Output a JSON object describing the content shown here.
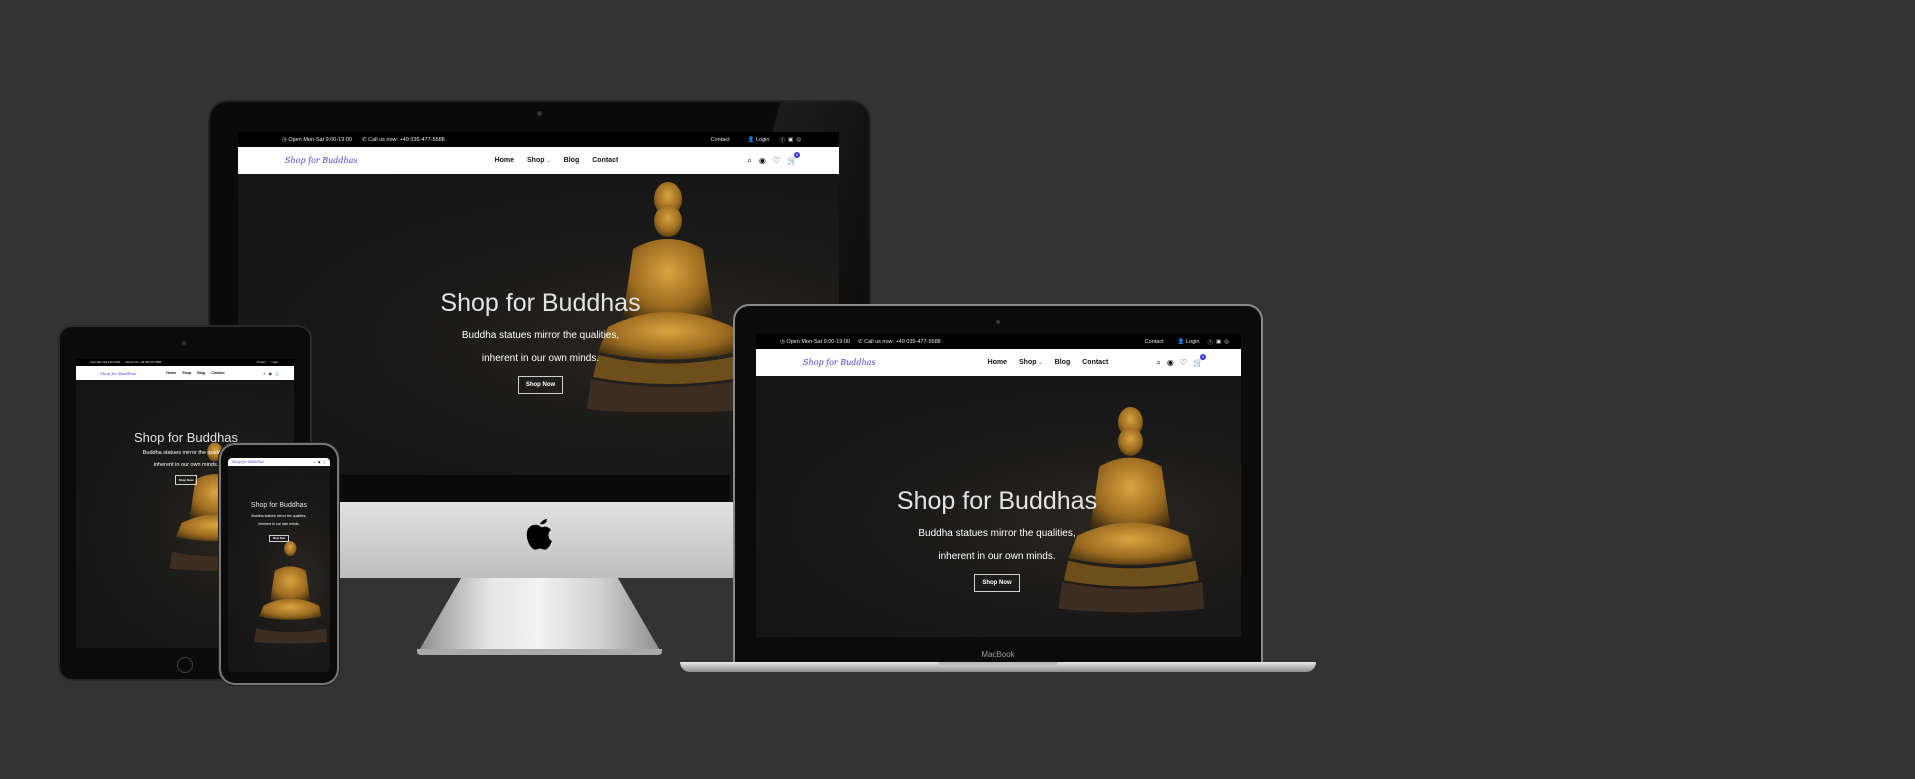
{
  "site": {
    "topbar": {
      "hours": "Open Mon-Sat 9:00-19:00",
      "phone": "Call us now: +49 035-477-5588",
      "contact": "Contact",
      "login": "Login"
    },
    "logo": "Shop for Buddhas",
    "menu": {
      "home": "Home",
      "shop": "Shop",
      "blog": "Blog",
      "contact": "Contact"
    },
    "cart_count": "0",
    "hero": {
      "title": "Shop for Buddhas",
      "line1": "Buddha statues mirror the qualities,",
      "line2": "inherent in our own minds.",
      "button": "Shop Now"
    }
  },
  "laptop_brand": "MacBook",
  "colors": {
    "background": "#333333",
    "accent": "#3b35e0",
    "logo": "#4b3fd6",
    "statue_gold": "#b8842c"
  },
  "icons": [
    "clock-icon",
    "phone-icon",
    "user-icon",
    "facebook-icon",
    "linkedin-icon",
    "github-icon",
    "search-icon",
    "account-icon",
    "heart-icon",
    "cart-icon",
    "apple-logo"
  ]
}
